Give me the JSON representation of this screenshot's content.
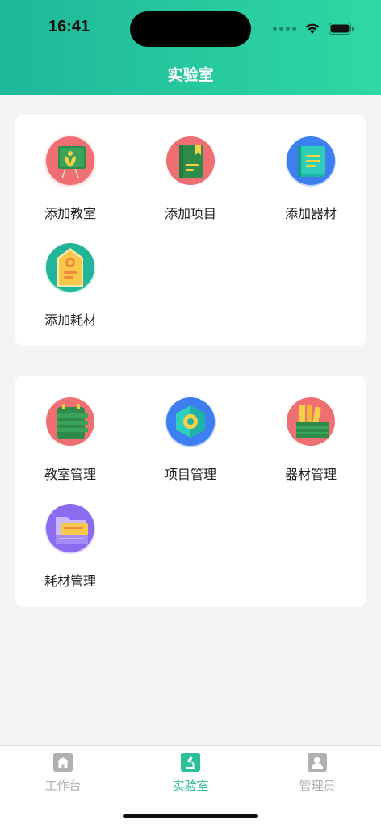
{
  "status_bar": {
    "time": "16:41"
  },
  "nav": {
    "title": "实验室"
  },
  "section_add": {
    "items": [
      {
        "label": "添加教室",
        "icon": "classroom-board-icon"
      },
      {
        "label": "添加项目",
        "icon": "project-book-icon"
      },
      {
        "label": "添加器材",
        "icon": "equipment-board-icon"
      },
      {
        "label": "添加耗材",
        "icon": "consumable-tag-icon"
      }
    ]
  },
  "section_manage": {
    "items": [
      {
        "label": "教室管理",
        "icon": "classroom-list-icon"
      },
      {
        "label": "项目管理",
        "icon": "project-hexagon-icon"
      },
      {
        "label": "器材管理",
        "icon": "equipment-shelf-icon"
      },
      {
        "label": "耗材管理",
        "icon": "consumable-folder-icon"
      }
    ]
  },
  "tabbar": {
    "tabs": [
      {
        "label": "工作台",
        "icon": "home-icon",
        "active": false
      },
      {
        "label": "实验室",
        "icon": "microscope-icon",
        "active": true
      },
      {
        "label": "管理员",
        "icon": "person-icon",
        "active": false
      }
    ]
  },
  "colors": {
    "header_start": "#1fb89a",
    "header_end": "#2ed8a3",
    "tab_active": "#2bbf9a",
    "tab_inactive": "#b0b0b0"
  }
}
